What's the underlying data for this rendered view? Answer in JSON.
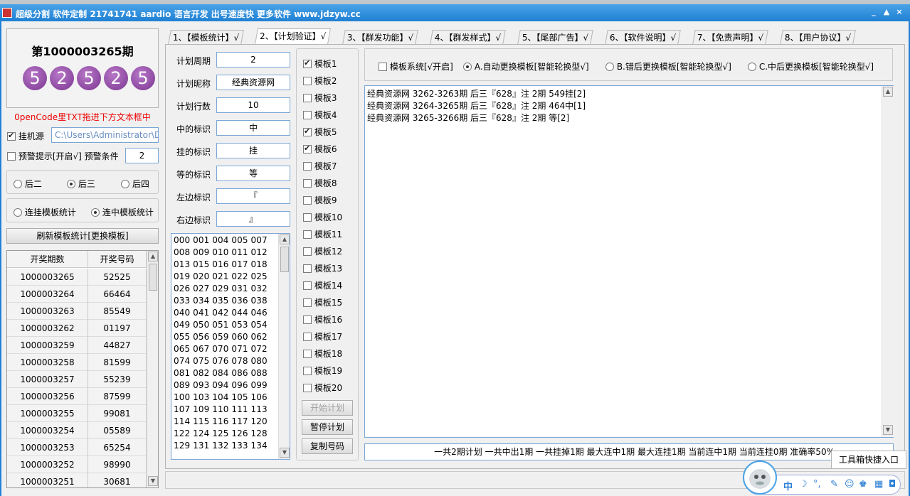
{
  "window": {
    "title": "超级分割 软件定制 21741741 aardio 语言开发 出号速度快 更多软件 www.jdzyw.cc",
    "btn_min": "_",
    "btn_max": "▲",
    "btn_close": "×"
  },
  "left": {
    "issue_title": "第1000003265期",
    "balls": [
      "5",
      "2",
      "5",
      "2",
      "5"
    ],
    "drag_tip": "0penCode里TXT拖进下方文本框中",
    "hook_source_label": "挂机源",
    "hook_source_path": "C:\\Users\\Administrator\\De",
    "warn_label": "预警提示[开启√] 预警条件",
    "warn_value": "2",
    "pos_options": [
      "后二",
      "后三",
      "后四"
    ],
    "stat_options": [
      "连挂模板统计",
      "连中模板统计"
    ],
    "refresh_button": "刷新模板统计[更换模板]",
    "history": {
      "headers": [
        "开奖期数",
        "开奖号码"
      ],
      "rows": [
        [
          "1000003265",
          "52525"
        ],
        [
          "1000003264",
          "66464"
        ],
        [
          "1000003263",
          "85549"
        ],
        [
          "1000003262",
          "01197"
        ],
        [
          "1000003259",
          "44827"
        ],
        [
          "1000003258",
          "81599"
        ],
        [
          "1000003257",
          "55239"
        ],
        [
          "1000003256",
          "87599"
        ],
        [
          "1000003255",
          "99081"
        ],
        [
          "1000003254",
          "05589"
        ],
        [
          "1000003253",
          "65254"
        ],
        [
          "1000003252",
          "98990"
        ],
        [
          "1000003251",
          "30681"
        ]
      ]
    }
  },
  "tabs": [
    "1、【模板统计】√",
    "2、【计划验证】√",
    "3、【群发功能】√",
    "4、【群发样式】√",
    "5、【尾部广告】√",
    "6、【软件说明】√",
    "7、【免责声明】√",
    "8、【用户协议】√"
  ],
  "plan": {
    "fields": [
      {
        "label": "计划周期",
        "value": "2"
      },
      {
        "label": "计划昵称",
        "value": "经典资源网"
      },
      {
        "label": "计划行数",
        "value": "10"
      },
      {
        "label": "中的标识",
        "value": "中"
      },
      {
        "label": "挂的标识",
        "value": "挂"
      },
      {
        "label": "等的标识",
        "value": "等"
      },
      {
        "label": "左边标识",
        "value": "『"
      },
      {
        "label": "右边标识",
        "value": "』"
      }
    ],
    "numbers": [
      "000 001 004 005 007",
      "008 009 010 011 012",
      "013 015 016 017 018",
      "019 020 021 022 025",
      "026 027 029 031 032",
      "033 034 035 036 038",
      "040 041 042 044 046",
      "049 050 051 053 054",
      "055 056 059 060 062",
      "065 067 070 071 072",
      "074 075 076 078 080",
      "081 082 084 086 088",
      "089 093 094 096 099",
      "100 103 104 105 106",
      "107 109 110 111 113",
      "114 115 116 117 120",
      "122 124 125 126 128",
      "129 131 132 133 134"
    ]
  },
  "templates": [
    {
      "label": "模板1",
      "checked": true
    },
    {
      "label": "模板2",
      "checked": false
    },
    {
      "label": "模板3",
      "checked": false
    },
    {
      "label": "模板4",
      "checked": false
    },
    {
      "label": "模板5",
      "checked": true
    },
    {
      "label": "模板6",
      "checked": true
    },
    {
      "label": "模板7",
      "checked": false
    },
    {
      "label": "模板8",
      "checked": false
    },
    {
      "label": "模板9",
      "checked": false
    },
    {
      "label": "模板10",
      "checked": false
    },
    {
      "label": "模板11",
      "checked": false
    },
    {
      "label": "模板12",
      "checked": false
    },
    {
      "label": "模板13",
      "checked": false
    },
    {
      "label": "模板14",
      "checked": false
    },
    {
      "label": "模板15",
      "checked": false
    },
    {
      "label": "模板16",
      "checked": false
    },
    {
      "label": "模板17",
      "checked": false
    },
    {
      "label": "模板18",
      "checked": false
    },
    {
      "label": "模板19",
      "checked": false
    },
    {
      "label": "模板20",
      "checked": false
    }
  ],
  "actions": {
    "start": "开始计划",
    "pause": "暂停计划",
    "copy": "复制号码"
  },
  "options": {
    "template_system": "模板系统[√开启]",
    "mode_a": "A.自动更换模板[智能轮换型√]",
    "mode_b": "B.错后更换模板[智能轮换型√]",
    "mode_c": "C.中后更换模板[智能轮换型√]"
  },
  "output": [
    "经典资源网 3262-3263期 后三『628』注 2期 549挂[2]",
    "经典资源网 3264-3265期 后三『628』注 2期 464中[1]",
    "经典资源网 3265-3266期 后三『628』注 2期 等[2]"
  ],
  "summary": "一共2期计划 一共中出1期 一共挂掉1期 最大连中1期 最大连挂1期 当前连中1期 当前连挂0期 准确率50%",
  "tooltip": "工具箱快捷入口",
  "ime": {
    "lang": "中",
    "moon": "☽",
    "punct": "°,",
    "icons": [
      "wrench-icon",
      "smile-icon",
      "shirt-icon",
      "grid-icon",
      "lock-icon"
    ]
  }
}
